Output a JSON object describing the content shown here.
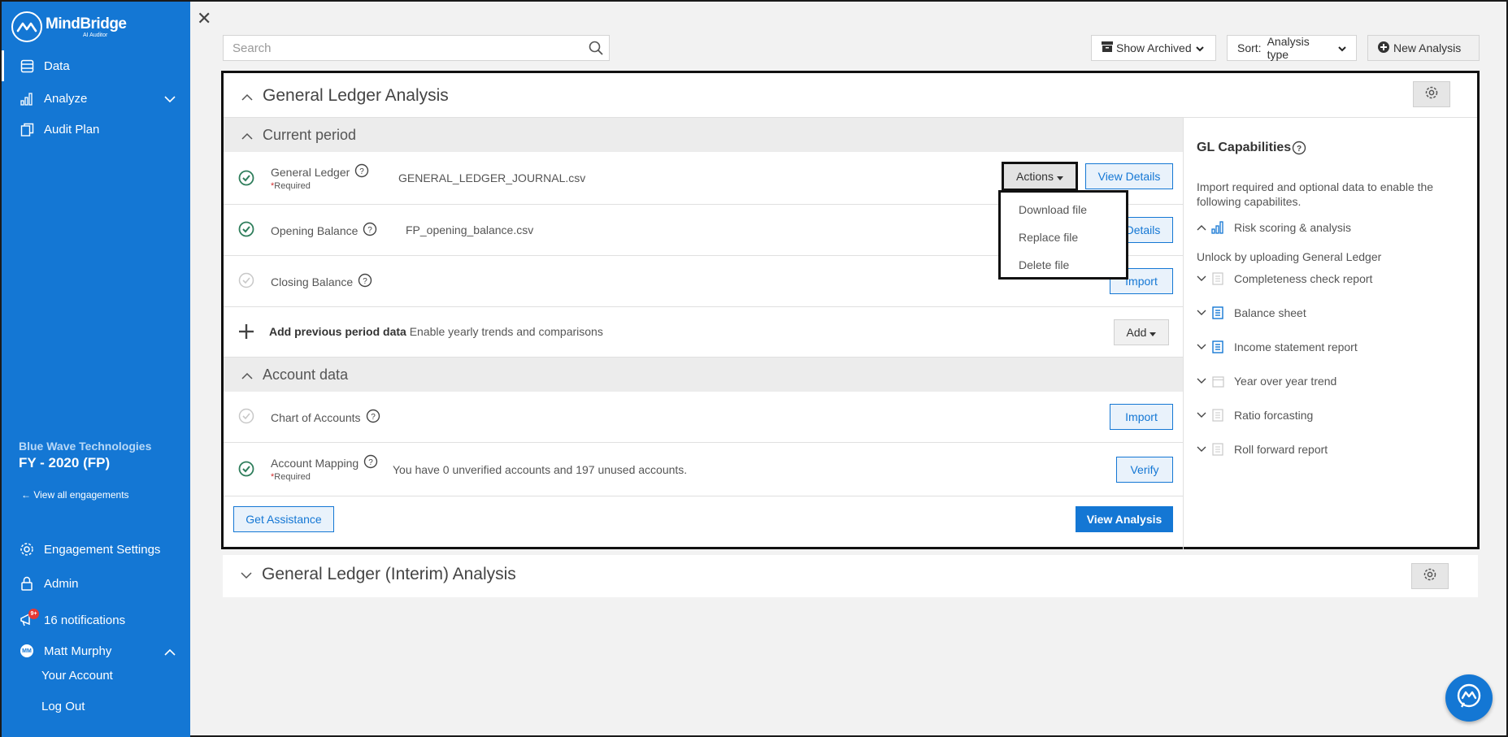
{
  "brand": {
    "name": "MindBridge",
    "tagline": "AI Auditor"
  },
  "sidebar": {
    "nav": [
      {
        "label": "Data",
        "icon": "database-icon"
      },
      {
        "label": "Analyze",
        "icon": "bar-chart-icon"
      },
      {
        "label": "Audit Plan",
        "icon": "clipboard-icon"
      }
    ],
    "engagement": {
      "company": "Blue Wave Technologies",
      "period": "FY - 2020 (FP)",
      "view_all": "View all engagements"
    },
    "bottom": {
      "settings": "Engagement Settings",
      "admin": "Admin",
      "notifications": "16 notifications",
      "notif_badge": "9+",
      "user_name": "Matt Murphy",
      "user_initials": "MM",
      "your_account": "Your Account",
      "log_out": "Log Out"
    }
  },
  "toolbar": {
    "search_placeholder": "Search",
    "show_archived": "Show Archived",
    "sort_label": "Sort:",
    "sort_value": "Analysis type",
    "new_analysis": "New Analysis"
  },
  "gl_panel": {
    "title": "General Ledger Analysis",
    "current_period": {
      "heading": "Current period",
      "general_ledger": {
        "label": "General Ledger",
        "required": "Required",
        "file": "GENERAL_LEDGER_JOURNAL.csv",
        "actions": "Actions",
        "view_details": "View Details"
      },
      "opening_balance": {
        "label": "Opening Balance",
        "file": "FP_opening_balance.csv",
        "view_details": "View Details"
      },
      "closing_balance": {
        "label": "Closing Balance",
        "import": "Import"
      },
      "previous_period": {
        "label": "Add previous period data",
        "hint": "Enable yearly trends and comparisons",
        "add": "Add"
      }
    },
    "actions_menu": [
      "Download file",
      "Replace file",
      "Delete file"
    ],
    "account_data": {
      "heading": "Account data",
      "chart_of_accounts": {
        "label": "Chart of Accounts",
        "import": "Import"
      },
      "account_mapping": {
        "label": "Account Mapping",
        "required": "Required",
        "message": "You have 0 unverified accounts and 197 unused accounts.",
        "verify": "Verify"
      }
    },
    "footer": {
      "get_assistance": "Get Assistance",
      "view_analysis": "View Analysis"
    },
    "capabilities": {
      "title": "GL Capabilities",
      "description": "Import required and optional data to enable the following capabilites.",
      "risk": "Risk scoring & analysis",
      "unlock": "Unlock by uploading General Ledger",
      "items": [
        {
          "label": "Completeness check report",
          "icon": "document-icon"
        },
        {
          "label": "Balance sheet",
          "icon": "report-icon"
        },
        {
          "label": "Income statement report",
          "icon": "report-icon"
        },
        {
          "label": "Year over year trend",
          "icon": "calendar-icon"
        },
        {
          "label": "Ratio forcasting",
          "icon": "document-icon"
        },
        {
          "label": "Roll forward report",
          "icon": "document-icon"
        }
      ]
    }
  },
  "interim_panel": {
    "title": "General Ledger (Interim) Analysis"
  },
  "colors": {
    "brand_blue": "#1477d4",
    "success_green": "#2e7d5b",
    "required_red": "#d32f2f"
  }
}
